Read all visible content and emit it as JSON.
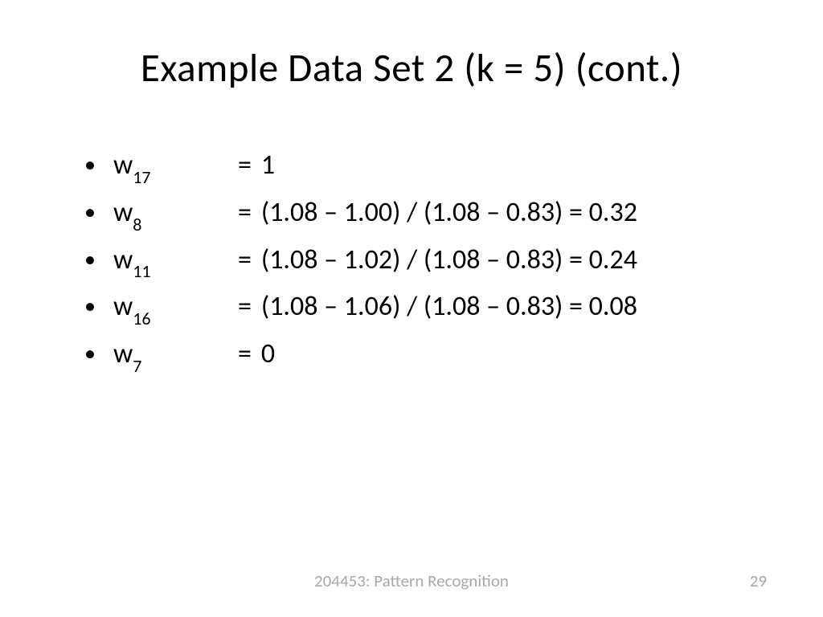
{
  "title": "Example Data Set 2 (k = 5) (cont.)",
  "items": [
    {
      "var": "w",
      "sub": "17",
      "rhs": "1"
    },
    {
      "var": "w",
      "sub": "8",
      "rhs": "(1.08 – 1.00) / (1.08 – 0.83) = 0.32"
    },
    {
      "var": "w",
      "sub": "11",
      "rhs": "(1.08 – 1.02) / (1.08 – 0.83) = 0.24"
    },
    {
      "var": "w",
      "sub": "16",
      "rhs": "(1.08 – 1.06) / (1.08 – 0.83) = 0.08"
    },
    {
      "var": "w",
      "sub": "7",
      "rhs": "0"
    }
  ],
  "footer": {
    "label": "204453: Pattern Recognition",
    "page": "29"
  },
  "eq": "="
}
